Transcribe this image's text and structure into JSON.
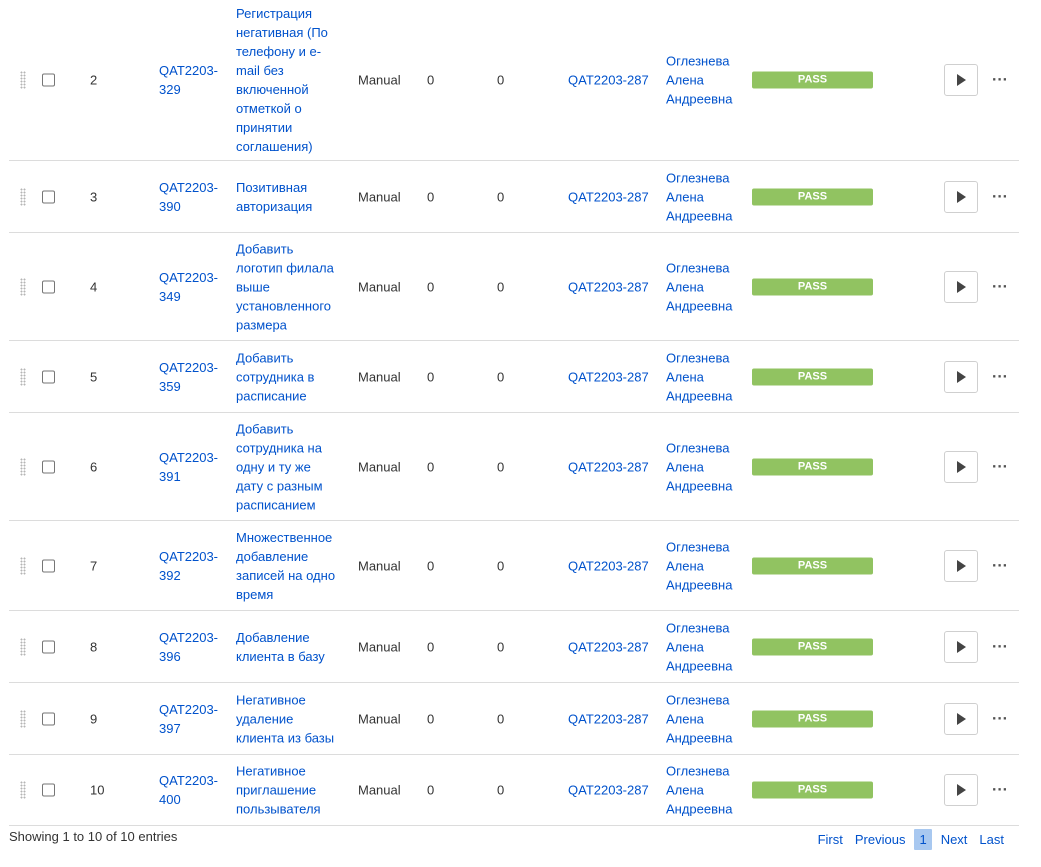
{
  "rows": [
    {
      "num": "2",
      "key": "QAT2203-329",
      "summary": "Регистрация негативная (По телефону и e-mail без включенной отметкой о принятии соглашения)",
      "exec": "Manual",
      "defects": "0",
      "attachments": "0",
      "issue": "QAT2203-287",
      "assignee": "Оглезнева Алена Андреевна",
      "status": "PASS"
    },
    {
      "num": "3",
      "key": "QAT2203-390",
      "summary": "Позитивная авторизация",
      "exec": "Manual",
      "defects": "0",
      "attachments": "0",
      "issue": "QAT2203-287",
      "assignee": "Оглезнева Алена Андреевна",
      "status": "PASS"
    },
    {
      "num": "4",
      "key": "QAT2203-349",
      "summary": "Добавить логотип филала выше установленного размера",
      "exec": "Manual",
      "defects": "0",
      "attachments": "0",
      "issue": "QAT2203-287",
      "assignee": "Оглезнева Алена Андреевна",
      "status": "PASS"
    },
    {
      "num": "5",
      "key": "QAT2203-359",
      "summary": "Добавить сотрудника в расписание",
      "exec": "Manual",
      "defects": "0",
      "attachments": "0",
      "issue": "QAT2203-287",
      "assignee": "Оглезнева Алена Андреевна",
      "status": "PASS"
    },
    {
      "num": "6",
      "key": "QAT2203-391",
      "summary": "Добавить сотрудника на одну и ту же дату с разным расписанием",
      "exec": "Manual",
      "defects": "0",
      "attachments": "0",
      "issue": "QAT2203-287",
      "assignee": "Оглезнева Алена Андреевна",
      "status": "PASS"
    },
    {
      "num": "7",
      "key": "QAT2203-392",
      "summary": "Множественное добавление записей на одно время",
      "exec": "Manual",
      "defects": "0",
      "attachments": "0",
      "issue": "QAT2203-287",
      "assignee": "Оглезнева Алена Андреевна",
      "status": "PASS"
    },
    {
      "num": "8",
      "key": "QAT2203-396",
      "summary": "Добавление клиента в базу",
      "exec": "Manual",
      "defects": "0",
      "attachments": "0",
      "issue": "QAT2203-287",
      "assignee": "Оглезнева Алена Андреевна",
      "status": "PASS"
    },
    {
      "num": "9",
      "key": "QAT2203-397",
      "summary": "Негативное удаление клиента из базы",
      "exec": "Manual",
      "defects": "0",
      "attachments": "0",
      "issue": "QAT2203-287",
      "assignee": "Оглезнева Алена Андреевна",
      "status": "PASS"
    },
    {
      "num": "10",
      "key": "QAT2203-400",
      "summary": "Негативное приглашение пользывателя",
      "exec": "Manual",
      "defects": "0",
      "attachments": "0",
      "issue": "QAT2203-287",
      "assignee": "Оглезнева Алена Андреевна",
      "status": "PASS"
    }
  ],
  "footer": {
    "info": "Showing 1 to 10 of 10 entries",
    "first": "First",
    "previous": "Previous",
    "page": "1",
    "next": "Next",
    "last": "Last"
  },
  "colors": {
    "pass": "#91c361",
    "link": "#0052cc",
    "active_page": "#a8c8f0"
  },
  "icons": {
    "drag": "drag-handle-icon",
    "play": "play-icon",
    "more": "more-icon"
  }
}
